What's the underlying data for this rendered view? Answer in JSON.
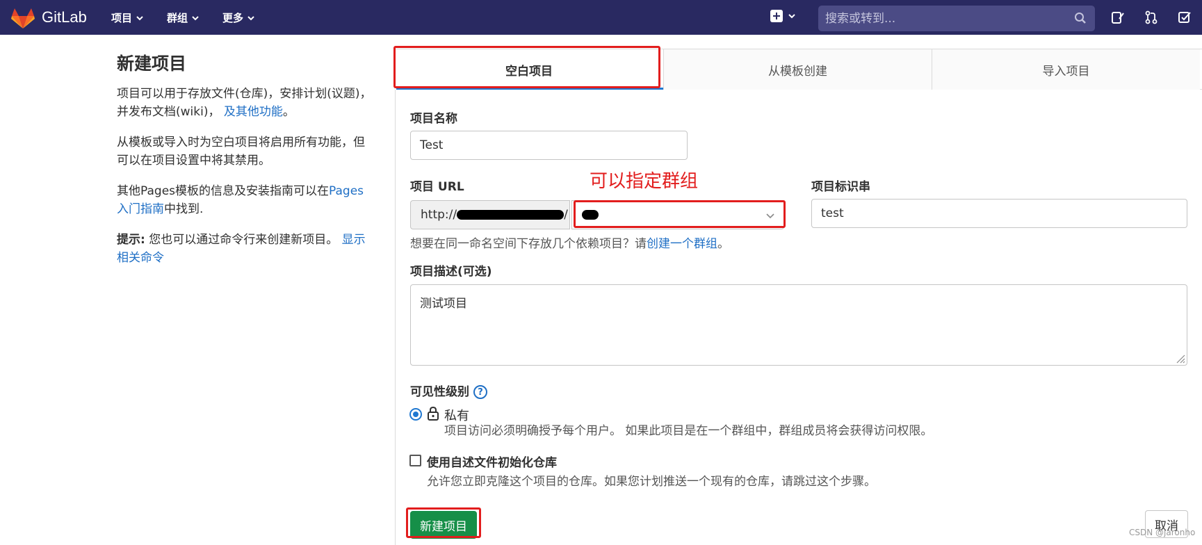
{
  "navbar": {
    "brand": "GitLab",
    "menus": [
      "项目",
      "群组",
      "更多"
    ],
    "search_placeholder": "搜索或转到..."
  },
  "sidebar": {
    "title": "新建项目",
    "p1_text": "项目可以用于存放文件(仓库)，安排计划(议题)，并发布文档(wiki)，",
    "p1_link": "及其他功能",
    "p1_end": "。",
    "p2_text": "从模板或导入时为空白项目将启用所有功能，但可以在项目设置中将其禁用。",
    "p3_text": "其他Pages模板的信息及安装指南可以在",
    "p3_link": "Pages入门指南",
    "p3_end": "中找到.",
    "tip_label": "提示:",
    "tip_text": " 您也可以通过命令行来创建新项目。 ",
    "tip_link": "显示相关命令"
  },
  "tabs": [
    "空白项目",
    "从模板创建",
    "导入项目"
  ],
  "form": {
    "name_label": "项目名称",
    "name_value": "Test",
    "url_label": "项目 URL",
    "url_prefix": "http://",
    "url_prefix_end": "/",
    "annotation": "可以指定群组",
    "slug_label": "项目标识串",
    "slug_value": "test",
    "help_text": "想要在同一命名空间下存放几个依赖项目？请",
    "help_link": "创建一个群组",
    "help_end": "。",
    "desc_label": "项目描述(可选)",
    "desc_value": "测试项目",
    "visibility_label": "可见性级别",
    "visibility_help": "?",
    "private_label": "私有",
    "private_desc": "项目访问必须明确授予每个用户。 如果此项目是在一个群组中，群组成员将会获得访问权限。",
    "readme_label": "使用自述文件初始化仓库",
    "readme_desc": "允许您立即克隆这个项目的仓库。如果您计划推送一个现有的仓库，请跳过这个步骤。",
    "create_button": "新建项目",
    "cancel_button": "取消"
  },
  "watermark": "CSDN @jaronho",
  "colors": {
    "navbar": "#292961",
    "primary": "#1f78d1",
    "success": "#168f48",
    "annotation": "#e21d1d"
  }
}
